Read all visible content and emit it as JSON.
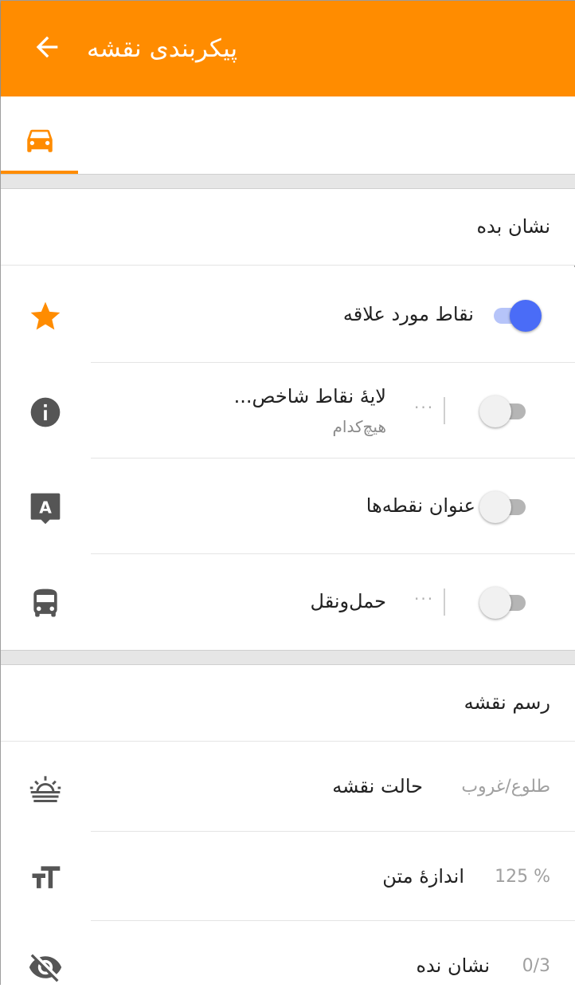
{
  "appbar": {
    "title": "پیکربندی نقشه",
    "back_icon": "arrow-back-icon"
  },
  "tabs": [
    {
      "icon": "car-icon",
      "selected": true
    }
  ],
  "colors": {
    "accent": "#ff8c00",
    "toggle_on": "#4a6cf7",
    "icon_gray": "#555555"
  },
  "show_section": {
    "header": "نشان بده",
    "items": [
      {
        "icon": "star-icon",
        "label": "نقاط مورد علاقه",
        "toggle": true
      },
      {
        "icon": "info-icon",
        "label": "لایهٔ نقاط شاخص...",
        "sublabel": "هیچ‌کدام",
        "more": "···",
        "toggle": false
      },
      {
        "icon": "label-marker-icon",
        "icon_letter": "A",
        "label": "عنوان نقطه‌ها",
        "toggle": false
      },
      {
        "icon": "bus-icon",
        "label": "حمل‌ونقل",
        "more": "···",
        "toggle": false
      }
    ]
  },
  "map_style_section": {
    "header": "رسم نقشه",
    "items": [
      {
        "icon": "sunset-icon",
        "label": "حالت نقشه",
        "value": "طلوع/غروب"
      },
      {
        "icon": "text-size-icon",
        "label": "اندازهٔ متن",
        "value": "125 %"
      },
      {
        "icon": "eye-off-icon",
        "label": "نشان نده",
        "value": "0/3"
      }
    ]
  }
}
